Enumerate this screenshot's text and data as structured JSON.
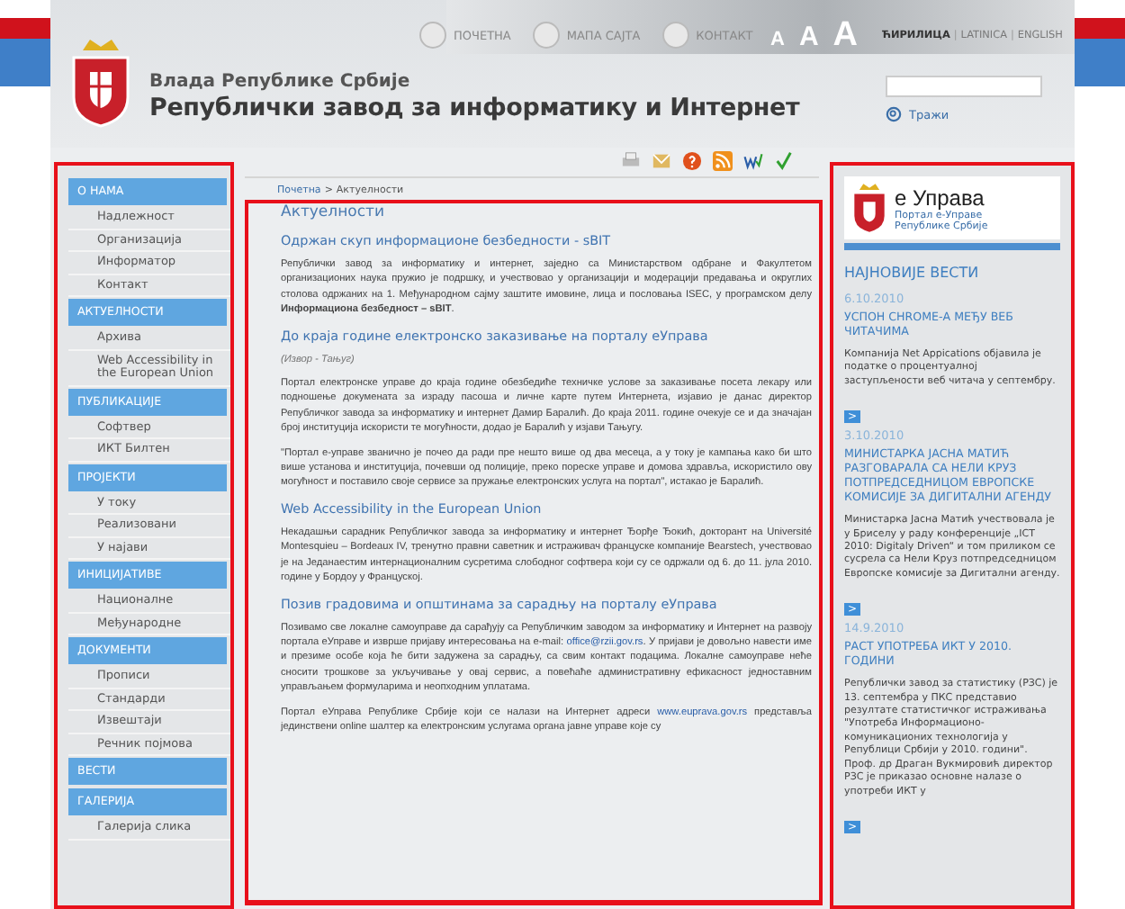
{
  "header": {
    "gov_name": "Влада Републике Србије",
    "institute_name": "Републички завод за информатику и Интернет",
    "top_links": [
      "ПОЧЕТНА",
      "МАПА САЈТА",
      "КОНТАКТ"
    ],
    "font_sizes": [
      "A",
      "A",
      "A"
    ],
    "languages": [
      {
        "label": "ЋИРИЛИЦА",
        "selected": true
      },
      {
        "label": "LATINICA",
        "selected": false
      },
      {
        "label": "ENGLISH",
        "selected": false
      }
    ],
    "language_separator": "|",
    "search_button": "Тражи"
  },
  "nav": [
    {
      "title": "О НАМА",
      "items": [
        "Надлежност",
        "Организација",
        "Информатор",
        "Контакт"
      ]
    },
    {
      "title": "АКТУЕЛНОСТИ",
      "items": [
        "Архива",
        "Web Accessibility in the European Union"
      ]
    },
    {
      "title": "ПУБЛИКАЦИЈЕ",
      "items": [
        "Софтвер",
        "ИКТ Билтен"
      ]
    },
    {
      "title": "ПРОЈЕКТИ",
      "items": [
        "У току",
        "Реализовани",
        "У најави"
      ]
    },
    {
      "title": "ИНИЦИЈАТИВЕ",
      "items": [
        "Националне",
        "Међународне"
      ]
    },
    {
      "title": "ДОКУМЕНТИ",
      "items": [
        "Прописи",
        "Стандарди",
        "Извештаји",
        "Речник појмова"
      ]
    },
    {
      "title": "ВЕСТИ"
    },
    {
      "title": "ГАЛЕРИЈА",
      "items": [
        "Галерија слика"
      ]
    }
  ],
  "breadcrumb": {
    "items": [
      "Почетна",
      "Актуелности"
    ],
    "separator": ">"
  },
  "main": {
    "title": "Актуелности",
    "articles": [
      {
        "title": "Одржан скуп информационе безбедности - sBIT",
        "paragraphs": [
          {
            "kind": "text",
            "segments": [
              {
                "kind": "text",
                "text": "Републички завод за информатику и интернет, заједно са Министарством одбране и Факултетом организационих наука пружио је подршку, и учествовао у организацији и модерацији предавања и округлих столова одржаних на 1. Међународном сајму заштите имовине, лица и пословања ISEC, у програмском делу **Информациона безбедност – sBIT**."
              }
            ]
          }
        ]
      },
      {
        "title": "До краја године електронско заказивање на порталу еУправа",
        "paragraphs": [
          {
            "kind": "source",
            "segments": [
              {
                "kind": "text",
                "text": "(Извор - Тањуг)"
              }
            ]
          },
          {
            "kind": "text",
            "segments": [
              {
                "kind": "text",
                "text": "Портал електронске управе до краја године обезбедиће техничке услове за заказивање посета лекару или подношење докумената за израду пасоша и личне карте путем Интернета, изјавио је данас директор Републичког завода за информатику и интернет Дамир Баралић. До краја 2011. године очекује се и да значајан број институција искористи те могућности, додао је Баралић у изјави Тањугу."
              }
            ]
          },
          {
            "kind": "text",
            "segments": [
              {
                "kind": "text",
                "text": "\"Портал е-управе званично је почео да ради пре нешто више од два месеца, а у току је кампања како би што више установа и институција, почевши од полиције, преко пореске управе и домова здравља, искористило ову могућност и поставило своје сервисе за пружање електронских услуга на портал\", истакао је Баралић."
              }
            ]
          }
        ]
      },
      {
        "title": "Web Accessibility in the European Union",
        "paragraphs": [
          {
            "kind": "text",
            "segments": [
              {
                "kind": "text",
                "text": "Некадашњи сарадник Републичког завода за информатику и интернет Ђорђе Ђокић, докторант на Université Montesquieu – Bordeaux IV, тренутно правни саветник и истраживач француске компаније Bearstech, учествовао је на Једанаестим интернационалним сусретима слободног софтвера који су се одржали од 6. до 11. јула 2010. године у Бордоу у Француској."
              }
            ]
          }
        ]
      },
      {
        "title": "Позив градовима и општинама за сарадњу на порталу еУправа",
        "paragraphs": [
          {
            "kind": "text",
            "segments": [
              {
                "kind": "text",
                "text": "Позивамо све локалне самоуправе да сарађују са Републичким заводом за информатику и Интернет на развоју портала еУправе и изврше пријаву интересовања на e-mail: "
              },
              {
                "kind": "link",
                "text": "office@rzii.gov.rs"
              },
              {
                "kind": "text",
                "text": ". У пријави је довољно навести име и презиме особе која ће бити задужена за сарадњу, са свим контакт подацима. Локалне самоуправе неће сносити трошкове за укључивање у овај сервис, а повећаће административну ефикасност једноставним управљањем формуларима и неопходним уплатама."
              }
            ]
          },
          {
            "kind": "text",
            "segments": [
              {
                "kind": "text",
                "text": "Портал еУправа Републике Србије који се налази на Интернет адреси "
              },
              {
                "kind": "link",
                "text": "www.euprava.gov.rs"
              },
              {
                "kind": "text",
                "text": " представља јединствени online шалтер ка електронским услугама органа јавне управе које су"
              }
            ]
          }
        ]
      }
    ]
  },
  "right": {
    "logo_title": "е Управа",
    "logo_subtitle": [
      "Портал е-Управе",
      "Републике Србије"
    ],
    "news_heading": "НАЈНОВИЈЕ ВЕСТИ",
    "more_label": ">",
    "news": [
      {
        "date": "6.10.2010",
        "title": "УСПОН CHROME-А МЕЂУ ВЕБ ЧИТАЧИМА",
        "summary": "Компанија Net Appications објавила је податке о процентуалној заступљености веб читача у септембру."
      },
      {
        "date": "3.10.2010",
        "title": "МИНИСТАРКА ЈАСНА МАТИЋ РАЗГОВАРАЛА СА НЕЛИ КРУЗ ПОТПРЕДСЕДНИЦОМ ЕВРОПСКЕ КОМИСИЈЕ ЗА ДИГИТАЛНИ АГЕНДУ",
        "summary": "Министарка Јасна Матић учествовала је у Бриселу у раду конференције „ICT 2010: Digitaly Driven“ и том приликом се сусрела са Нели Круз потпредседницом Европске комисије за Дигитални агенду."
      },
      {
        "date": "14.9.2010",
        "title": "РАСТ УПОТРЕБА ИКТ У 2010. ГОДИНИ",
        "summary": "Републички завод за статистику (РЗС) је 13. септембра у ПКС представио резултате статистичког истраживања \"Употреба Информационо-комуникационих технологија у Републици Србији у 2010. години\". Проф. др Драган Вукмировић директор РЗС је приказао основне налазе о употреби ИКТ у"
      }
    ]
  }
}
